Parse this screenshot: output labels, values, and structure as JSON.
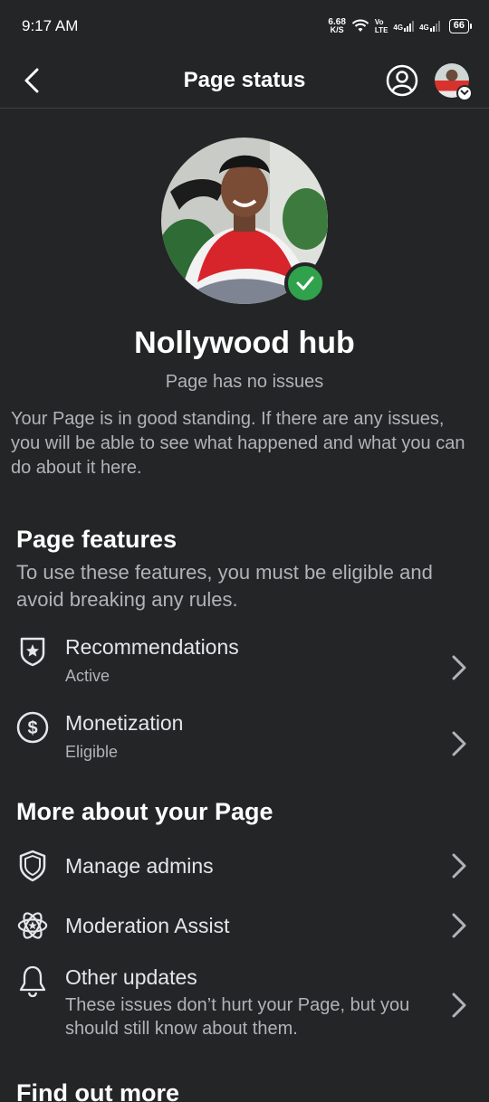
{
  "status_bar": {
    "time": "9:17 AM",
    "speed_value": "6.68",
    "speed_unit": "K/S",
    "volte_top": "Vo",
    "volte_bottom": "LTE",
    "net1": "4G",
    "net2": "4G",
    "battery": "66"
  },
  "header": {
    "title": "Page status",
    "back_icon": "chevron-left-icon",
    "account_icon": "person-circle-icon"
  },
  "profile": {
    "name": "Nollywood hub",
    "status": "Page has no issues",
    "description": "Your Page is in good standing. If there are any issues, you will be able to see what happened and what you can do about it here."
  },
  "features": {
    "title": "Page features",
    "description": "To use these features, you must be eligible and avoid breaking any rules.",
    "items": [
      {
        "label": "Recommendations",
        "sub": "Active",
        "icon": "star-shield-icon"
      },
      {
        "label": "Monetization",
        "sub": "Eligible",
        "icon": "dollar-circle-icon"
      }
    ]
  },
  "more": {
    "title": "More about your Page",
    "items": [
      {
        "label": "Manage admins",
        "icon": "shield-icon"
      },
      {
        "label": "Moderation Assist",
        "icon": "atom-icon"
      },
      {
        "label": "Other updates",
        "sub": "These issues don’t hurt your Page, but you should still know about them.",
        "icon": "bell-icon"
      }
    ]
  },
  "find_more": {
    "title": "Find out more"
  },
  "colors": {
    "background": "#242526",
    "verified_green": "#31a24c",
    "secondary_text": "#b0b3b8"
  }
}
